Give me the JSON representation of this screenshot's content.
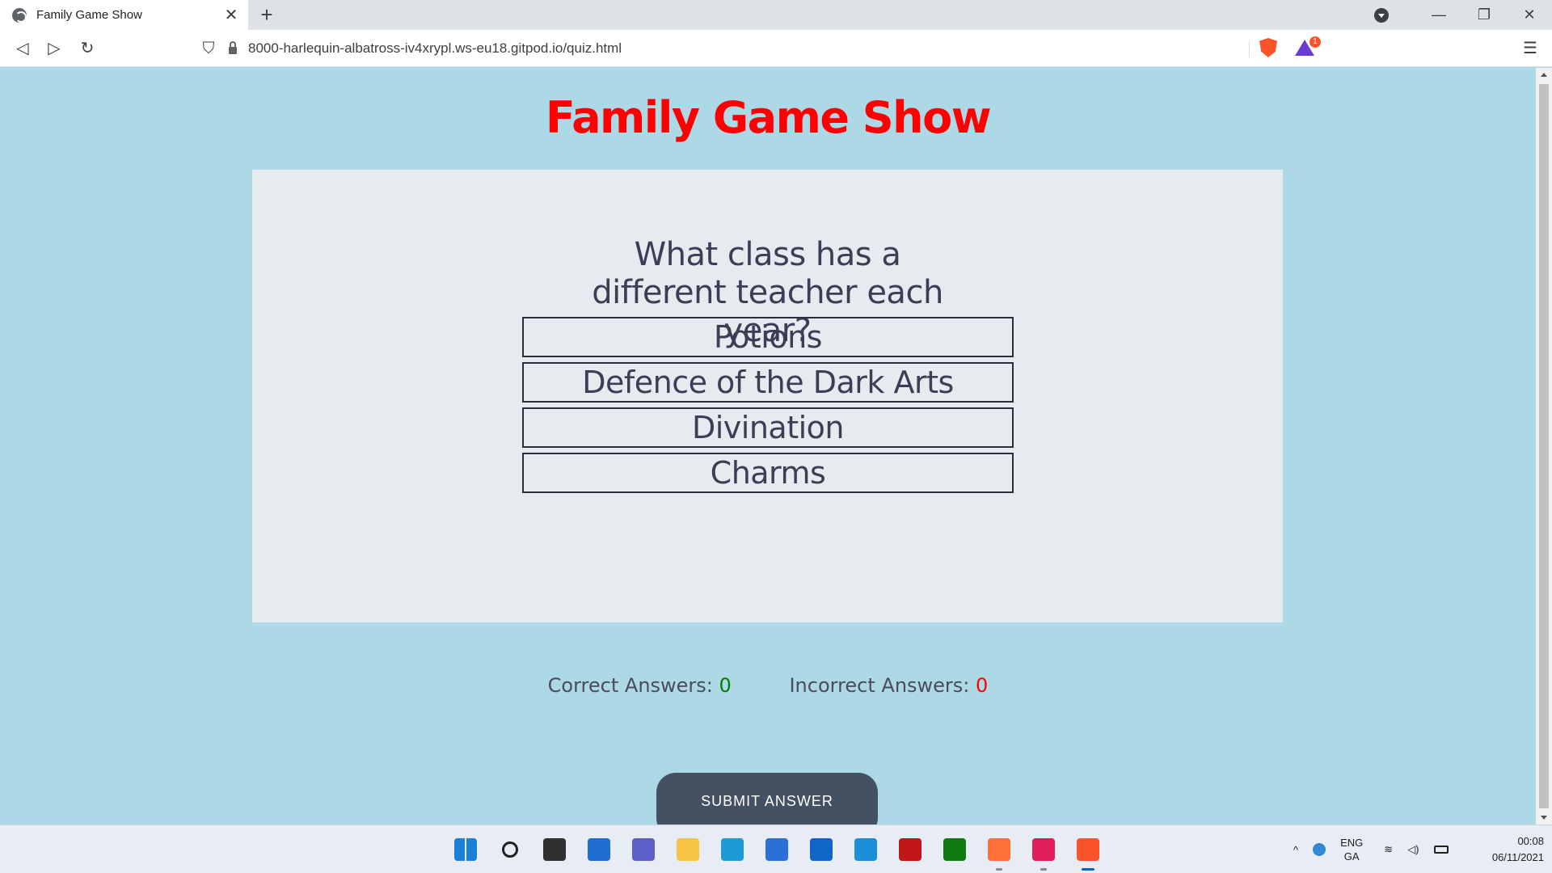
{
  "browser": {
    "tab_title": "Family Game Show",
    "tab_close": "✕",
    "new_tab": "+",
    "url": "8000-harlequin-albatross-iv4xrypl.ws-eu18.gitpod.io/quiz.html",
    "rewards_badge": "1",
    "nav": {
      "back": "◁",
      "forward": "▷",
      "reload": "↻",
      "bookmark": "⛉",
      "menu": "☰"
    },
    "window": {
      "minimize": "—",
      "restore": "❐",
      "close": "✕"
    }
  },
  "page": {
    "title": "Family Game Show",
    "question": "What class has a different teacher each year?",
    "answers": [
      "Potions",
      "Defence of the Dark Arts",
      "Divination",
      "Charms"
    ],
    "correct_label": "Correct Answers:",
    "correct_value": "0",
    "incorrect_label": "Incorrect Answers:",
    "incorrect_value": "0",
    "submit_label": "SUBMIT ANSWER"
  },
  "taskbar": {
    "apps": [
      {
        "name": "start-icon",
        "color": "#1a7fd6"
      },
      {
        "name": "search-icon",
        "color": "#202020"
      },
      {
        "name": "task-view-icon",
        "color": "#303030"
      },
      {
        "name": "widgets-icon",
        "color": "#1f6fd1"
      },
      {
        "name": "chat-icon",
        "color": "#5b5fc7"
      },
      {
        "name": "file-explorer-icon",
        "color": "#f6c344"
      },
      {
        "name": "edge-icon",
        "color": "#1e9bd7"
      },
      {
        "name": "store-icon",
        "color": "#2c6fd6"
      },
      {
        "name": "mail-icon",
        "color": "#1066c7"
      },
      {
        "name": "app-l-icon",
        "color": "#1b8fd8"
      },
      {
        "name": "mcafee-icon",
        "color": "#c01818"
      },
      {
        "name": "xbox-icon",
        "color": "#107c10"
      },
      {
        "name": "firefox-icon",
        "color": "#ff7139"
      },
      {
        "name": "slack-icon",
        "color": "#e01e5a"
      },
      {
        "name": "brave-icon",
        "color": "#fb542b"
      }
    ],
    "lang_top": "ENG",
    "lang_bottom": "GA",
    "time": "00:08",
    "date": "06/11/2021"
  }
}
